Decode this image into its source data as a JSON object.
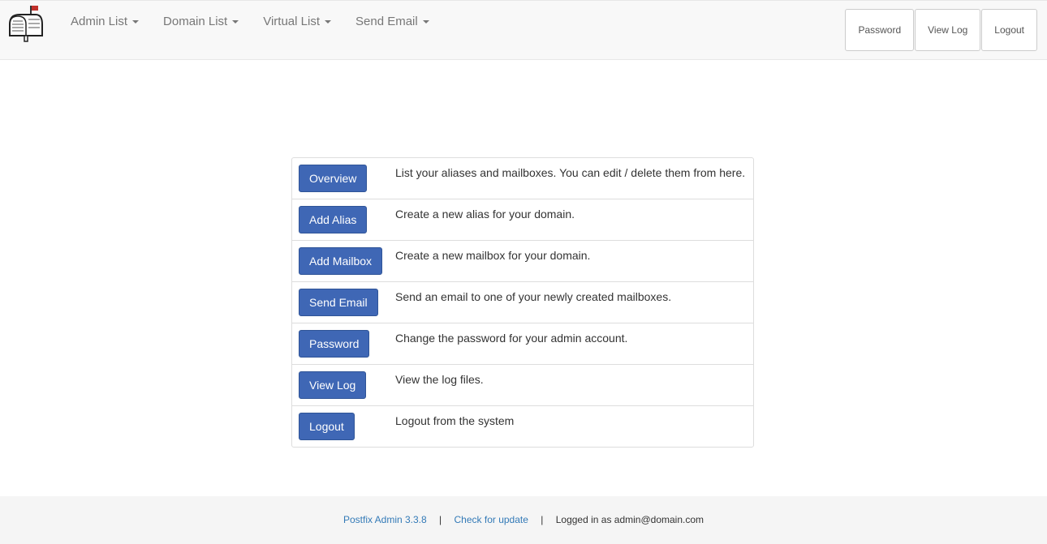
{
  "navbar": {
    "menu": [
      {
        "label": "Admin List"
      },
      {
        "label": "Domain List"
      },
      {
        "label": "Virtual List"
      },
      {
        "label": "Send Email"
      }
    ],
    "right_buttons": [
      {
        "label": "Password"
      },
      {
        "label": "View Log"
      },
      {
        "label": "Logout"
      }
    ]
  },
  "main": {
    "rows": [
      {
        "button": "Overview",
        "description": "List your aliases and mailboxes. You can edit / delete them from here."
      },
      {
        "button": "Add Alias",
        "description": "Create a new alias for your domain."
      },
      {
        "button": "Add Mailbox",
        "description": "Create a new mailbox for your domain."
      },
      {
        "button": "Send Email",
        "description": "Send an email to one of your newly created mailboxes."
      },
      {
        "button": "Password",
        "description": "Change the password for your admin account."
      },
      {
        "button": "View Log",
        "description": "View the log files."
      },
      {
        "button": "Logout",
        "description": "Logout from the system"
      }
    ]
  },
  "footer": {
    "version_link": "Postfix Admin 3.3.8",
    "separator": "|",
    "update_link": "Check for update",
    "logged_in": "Logged in as admin@domain.com"
  },
  "colors": {
    "primary_button": "#3f67b5",
    "link": "#337ab7",
    "navbar_bg": "#f8f8f8",
    "footer_bg": "#f5f5f5"
  }
}
